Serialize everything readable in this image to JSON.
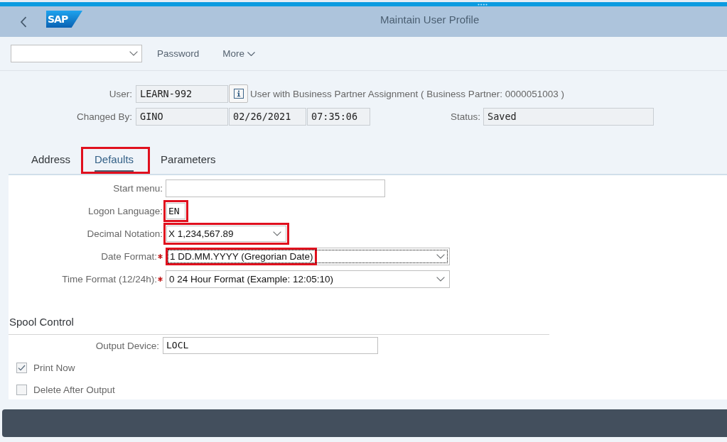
{
  "header": {
    "logo": "SAP",
    "title": "Maintain User Profile"
  },
  "toolbar": {
    "actions": [
      {
        "label": "Password",
        "kind": "button"
      },
      {
        "label": "More",
        "kind": "menu"
      }
    ]
  },
  "user_details": {
    "user": {
      "label": "User:",
      "value": "LEARN-992",
      "description": "User with Business Partner Assignment ( Business Partner: 0000051003 )"
    },
    "changed_by": {
      "label": "Changed By:",
      "user": "GINO",
      "date": "02/26/2021",
      "time": "07:35:06"
    },
    "status": {
      "label": "Status:",
      "value": "Saved"
    }
  },
  "tabs": [
    {
      "label": "Address",
      "selected": false,
      "highlighted": false
    },
    {
      "label": "Defaults",
      "selected": true,
      "highlighted": true
    },
    {
      "label": "Parameters",
      "selected": false,
      "highlighted": false
    }
  ],
  "defaults": {
    "fields": [
      {
        "kind": "input",
        "label": "Start menu:",
        "required": false,
        "focused": false,
        "control_highlighted": false,
        "value_highlighted": false
      },
      {
        "kind": "input",
        "label": "Logon Language:",
        "value": "EN",
        "required": false,
        "focused": false,
        "control_highlighted": true,
        "value_highlighted": false
      },
      {
        "kind": "dropdown",
        "label": "Decimal Notation:",
        "value": "X 1,234,567.89",
        "required": false,
        "focused": false,
        "control_highlighted": true,
        "value_highlighted": false
      },
      {
        "kind": "dropdown",
        "label": "Date Format:",
        "value": "1 DD.MM.YYYY (Gregorian Date)",
        "required": true,
        "focused": true,
        "control_highlighted": false,
        "value_highlighted": true
      },
      {
        "kind": "dropdown",
        "label": "Time Format (12/24h):",
        "value": "0 24 Hour Format (Example: 12:05:10)",
        "required": true,
        "focused": false,
        "control_highlighted": false,
        "value_highlighted": false
      }
    ]
  },
  "spool_control": {
    "title": "Spool Control",
    "output_device": {
      "label": "Output Device:",
      "value": "LOCL"
    },
    "options": [
      {
        "label": "Print Now",
        "checked": true
      },
      {
        "label": "Delete After Output",
        "checked": false
      }
    ]
  }
}
